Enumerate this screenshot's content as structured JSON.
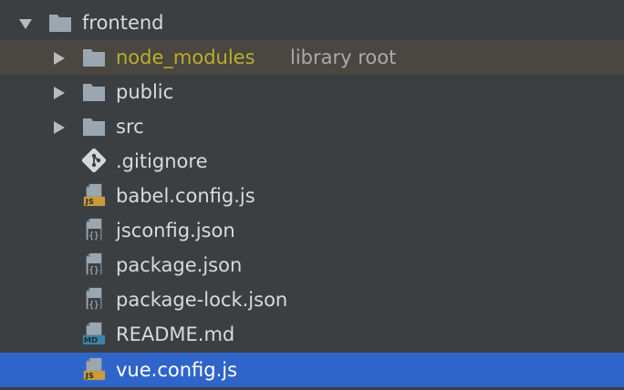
{
  "colors": {
    "panel_bg": "#3c3f41",
    "selection_bg": "#2f65ca",
    "excluded_bg": "#4a4640",
    "excluded_text": "#b8b12b",
    "folder_icon": "#9aa7b0",
    "js_badge": "#c99b3c",
    "md_badge": "#3c84a8"
  },
  "tree": {
    "root": {
      "label": "frontend",
      "expanded": true,
      "icon": "folder-icon"
    },
    "items": [
      {
        "label": "node_modules",
        "suffix": "library root",
        "type": "folder",
        "icon": "folder-icon",
        "state": "excluded"
      },
      {
        "label": "public",
        "type": "folder",
        "icon": "folder-icon"
      },
      {
        "label": "src",
        "type": "folder",
        "icon": "folder-icon"
      },
      {
        "label": ".gitignore",
        "type": "file",
        "icon": "git-file-icon"
      },
      {
        "label": "babel.config.js",
        "type": "file",
        "icon": "js-file-icon",
        "badge": "JS"
      },
      {
        "label": "jsconfig.json",
        "type": "file",
        "icon": "json-file-icon"
      },
      {
        "label": "package.json",
        "type": "file",
        "icon": "json-file-icon"
      },
      {
        "label": "package-lock.json",
        "type": "file",
        "icon": "json-file-icon"
      },
      {
        "label": "README.md",
        "type": "file",
        "icon": "markdown-file-icon",
        "badge": "MD"
      },
      {
        "label": "vue.config.js",
        "type": "file",
        "icon": "js-file-icon",
        "badge": "JS",
        "state": "selected"
      }
    ]
  }
}
